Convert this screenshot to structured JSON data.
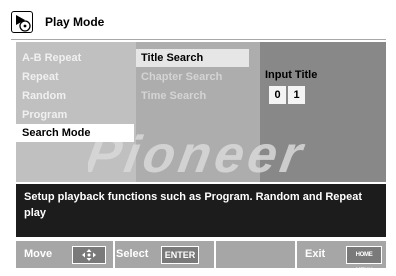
{
  "header": {
    "title": "Play Mode",
    "icon": "disc-play-icon"
  },
  "menu": {
    "items": [
      {
        "label": "A-B Repeat",
        "selected": false
      },
      {
        "label": "Repeat",
        "selected": false
      },
      {
        "label": "Random",
        "selected": false
      },
      {
        "label": "Program",
        "selected": false
      },
      {
        "label": "Search Mode",
        "selected": true
      }
    ]
  },
  "submenu": {
    "items": [
      {
        "label": "Title Search",
        "active": true
      },
      {
        "label": "Chapter Search",
        "active": false
      },
      {
        "label": "Time Search",
        "active": false
      }
    ]
  },
  "input": {
    "label": "Input Title",
    "digits": [
      "0",
      "1"
    ]
  },
  "watermark": {
    "text": "Pioneer"
  },
  "info": {
    "text": "Setup playback functions such as Program. Random and Repeat play"
  },
  "footer": {
    "move_label": "Move",
    "move_icon": "directional-pad-icon",
    "select_label": "Select",
    "enter_key": "ENTER",
    "exit_label": "Exit",
    "home_key": "HOME MENU"
  },
  "colors": {
    "panel": "#c0c0c0",
    "panel_mid": "#adadad",
    "panel_right": "#888888",
    "info_bar": "#1c1c1c",
    "footer": "#a6a6a6",
    "selected_bg": "#ffffff"
  }
}
